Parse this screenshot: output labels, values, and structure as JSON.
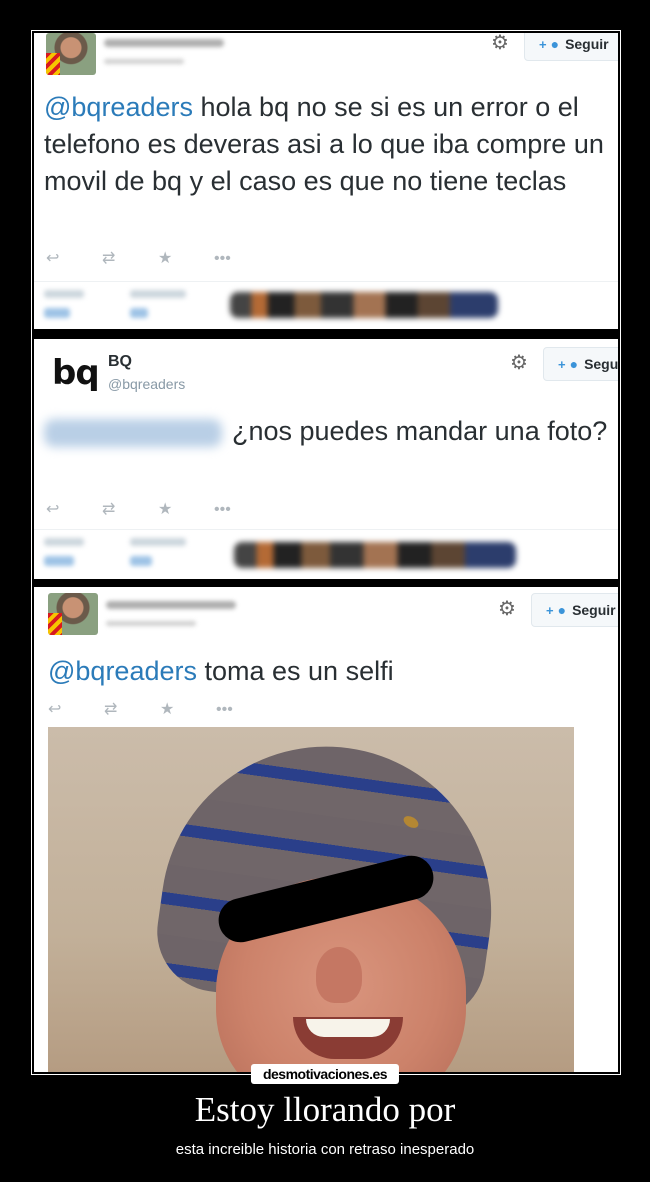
{
  "tweets": [
    {
      "follow_label": "Seguir",
      "mention": "@bqreaders",
      "text": " hola bq no se si es un error o el telefono es deveras asi a lo que iba compre un movil de bq y el caso es que no tiene teclas"
    },
    {
      "logo": "bq",
      "name": "BQ",
      "handle": "@bqreaders",
      "follow_label": "Segu",
      "text": "¿nos puedes mandar una foto?"
    },
    {
      "follow_label": "Seguir",
      "mention": "@bqreaders",
      "text": " toma es un selfi"
    }
  ],
  "icons": {
    "gear": "⚙",
    "reply": "↩",
    "retweet": "⇄",
    "favorite": "★",
    "more": "•••",
    "follow": "+👤"
  },
  "footer": {
    "site": "desmotivaciones.es",
    "title": "Estoy llorando por",
    "subtitle": "esta increible historia con retraso inesperado"
  },
  "colors": {
    "mention": "#2b7bb9",
    "follow_icon": "#3b94d9",
    "background": "#000000"
  }
}
